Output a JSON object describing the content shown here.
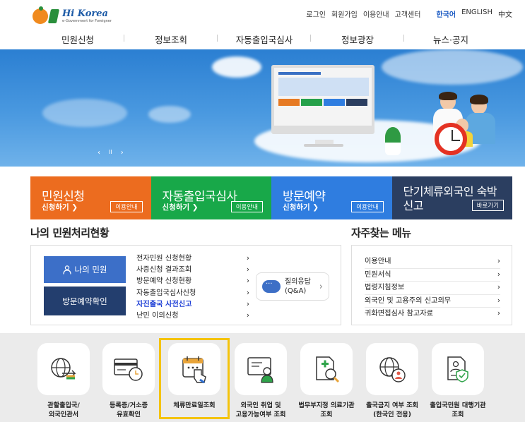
{
  "logo": {
    "name": "Hi Korea",
    "tagline": "e-Government for Foreigner"
  },
  "util_nav": [
    "로그인",
    "회원가입",
    "이용안내",
    "고객센터"
  ],
  "languages": {
    "active": "한국어",
    "others": [
      "ENGLISH",
      "中文"
    ]
  },
  "gnb": [
    "민원신청",
    "정보조회",
    "자동출입국심사",
    "정보광장",
    "뉴스·공지"
  ],
  "banner": {
    "controls": {
      "prev": "‹",
      "pause": "II",
      "next": "›"
    }
  },
  "tiles": [
    {
      "title": "민원신청",
      "sub": "신청하기 ❯",
      "btn": "이용안내",
      "color": "#ec6c1f"
    },
    {
      "title": "자동출입국심사",
      "sub": "신청하기 ❯",
      "btn": "이용안내",
      "color": "#18a849"
    },
    {
      "title": "방문예약",
      "sub": "신청하기 ❯",
      "btn": "이용안내",
      "color": "#2f7de0"
    },
    {
      "title": "단기체류외국인 숙박신고",
      "btn": "바로가기",
      "color": "#2b3e60"
    }
  ],
  "status": {
    "heading": "나의 민원처리현황",
    "my_button": "나의 민원",
    "visit_button": "방문예약확인",
    "links": [
      "전자민원 신청현황",
      "사증신청 결과조회",
      "방문예약 신청현황",
      "자동출입국심사신청",
      "자진출국 사전신고",
      "난민 이의신청"
    ],
    "highlight_index": 4,
    "qa_line1": "질의응답",
    "qa_line2": "(Q&A)"
  },
  "faq": {
    "heading": "자주찾는 메뉴",
    "items": [
      "이용안내",
      "민원서식",
      "법령지침정보",
      "외국인 및 고용주의 신고의무",
      "귀화면접심사 참고자료"
    ]
  },
  "bottom_icons": [
    {
      "l1": "관할출입국/",
      "l2": "외국인관서",
      "icon": "globe-arrows-icon"
    },
    {
      "l1": "등록증/거소증",
      "l2": "유효확인",
      "icon": "id-card-clock-icon"
    },
    {
      "l1": "체류만료일조회",
      "l2": "",
      "icon": "calendar-hand-icon"
    },
    {
      "l1": "외국인 취업 및",
      "l2": "고용가능여부 조회",
      "icon": "worker-screen-icon"
    },
    {
      "l1": "법무부지정 의료기관",
      "l2": "조회",
      "icon": "medical-search-icon"
    },
    {
      "l1": "출국금지 여부 조회",
      "l2": "(한국인 전용)",
      "icon": "globe-person-icon"
    },
    {
      "l1": "출입국민원 대행기관",
      "l2": "조회",
      "icon": "agent-doc-icon"
    }
  ],
  "arrow": "›"
}
